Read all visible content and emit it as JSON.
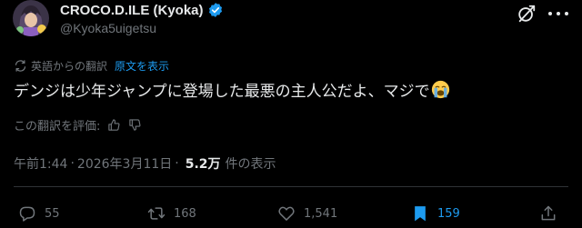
{
  "author": {
    "display_name": "CROCO.D.ILE (Kyoka)",
    "handle": "@Kyoka5uigetsu",
    "verified": true
  },
  "translation": {
    "label": "英語からの翻訳",
    "show_original": "原文を表示"
  },
  "tweet": {
    "text": "デンジは少年ジャンプに登場した最悪の主人公だよ、マジで",
    "emoji": "loudly-crying-face"
  },
  "rating": {
    "label": "この翻訳を評価:"
  },
  "meta": {
    "time": "午前1:44",
    "separator": "·",
    "date": "2026年3月11日",
    "views_count": "5.2万",
    "views_label": "件の表示"
  },
  "actions": {
    "replies": "55",
    "reposts": "168",
    "likes": "1,541",
    "bookmarks": "159"
  },
  "colors": {
    "background": "#000000",
    "text": "#e7e9ea",
    "secondary": "#71767b",
    "accent": "#1d9bf0",
    "divider": "#2f3336"
  }
}
